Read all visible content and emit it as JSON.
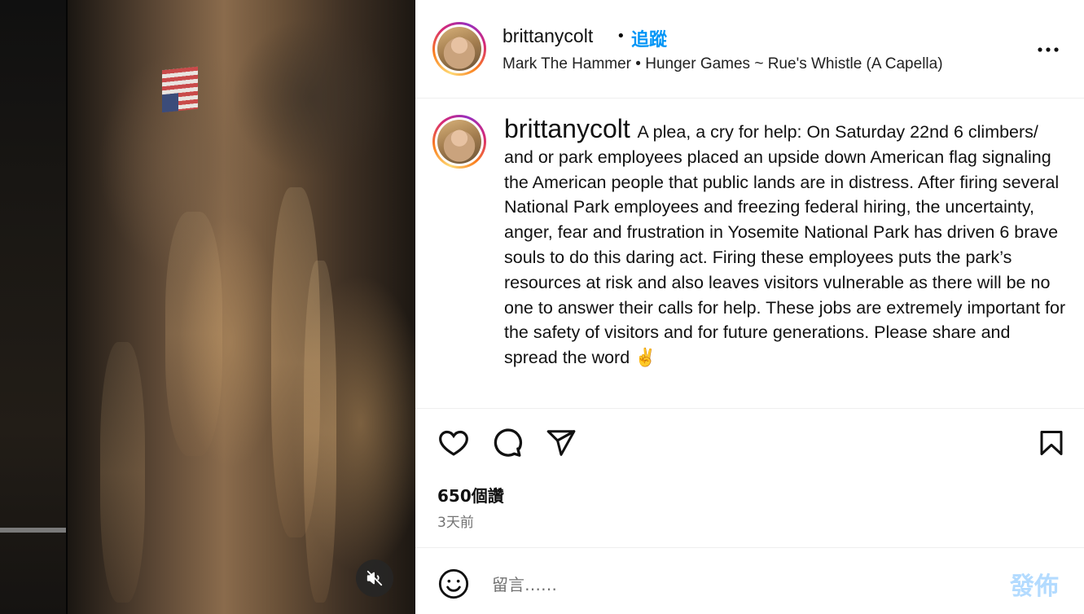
{
  "post": {
    "username": "brittanycolt",
    "follow_label": "追蹤",
    "separator": "•",
    "audio": "Mark The Hammer • Hunger Games ~ Rue's Whistle (A Capella)",
    "caption": "A plea, a cry for help: On Saturday 22nd 6 climbers/ and or park employees placed an upside down American flag signaling the American people that public lands are in distress. After firing several National Park employees and freezing federal hiring, the uncertainty, anger, fear and frustration in Yosemite National Park has driven 6 brave souls to do this daring act. Firing these employees puts the park’s resources at risk and also leaves visitors vulnerable as there will be no one to answer their calls for help. These jobs are extremely important for the safety of visitors and for future generations. Please share and spread the word ✌",
    "likes": "650個讚",
    "time_ago": "3天前"
  },
  "comment": {
    "placeholder": "留言……",
    "post_label": "發佈"
  },
  "icons": {
    "more": "more-options-icon",
    "like": "heart-icon",
    "comment": "comment-bubble-icon",
    "share": "paper-plane-icon",
    "save": "bookmark-icon",
    "emoji": "smiley-icon",
    "mute": "speaker-muted-icon"
  },
  "colors": {
    "accent": "#0095f6",
    "post_disabled": "#b3dbff",
    "muted_text": "#737373"
  }
}
